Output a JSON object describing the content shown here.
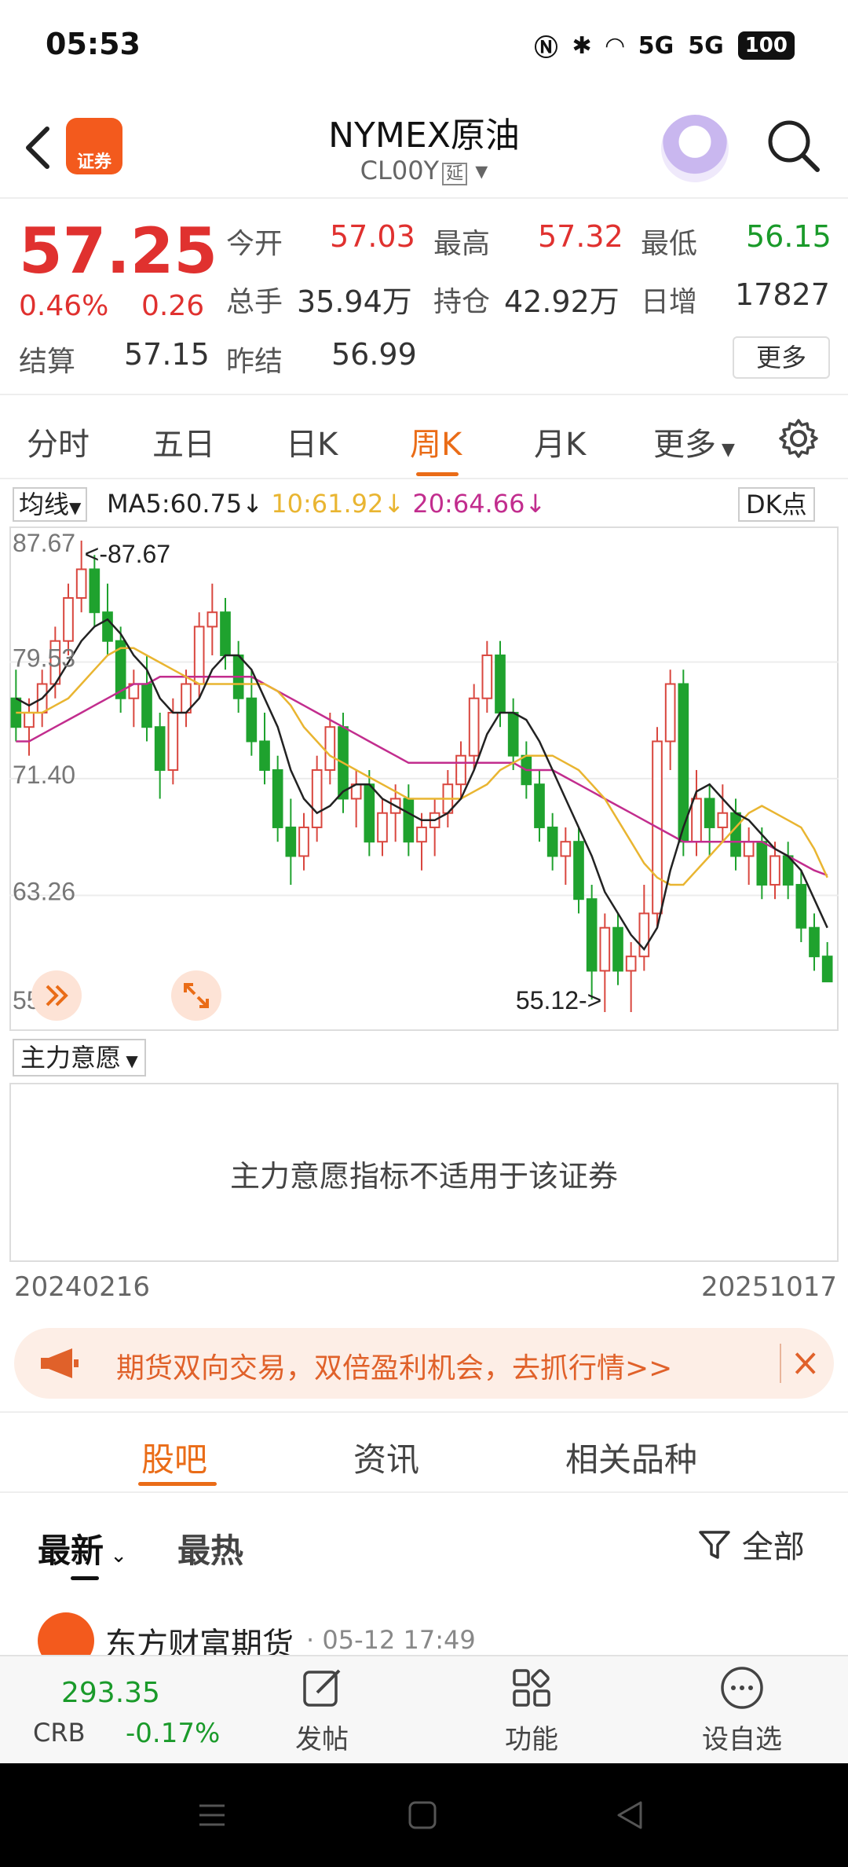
{
  "status": {
    "time": "05:53",
    "battery": "100",
    "net1": "5G",
    "net2": "5G"
  },
  "header": {
    "title": "NYMEX原油",
    "code": "CL00Y",
    "delay_tag": "延",
    "logo_text": "证券"
  },
  "quote": {
    "last": "57.25",
    "change_pct": "0.46%",
    "change": "0.26",
    "open_label": "今开",
    "open": "57.03",
    "high_label": "最高",
    "high": "57.32",
    "low_label": "最低",
    "low": "56.15",
    "volume_label": "总手",
    "volume": "35.94万",
    "oi_label": "持仓",
    "oi": "42.92万",
    "daily_inc_label": "日增",
    "daily_inc": "17827",
    "settle_label": "结算",
    "settle": "57.15",
    "prev_settle_label": "昨结",
    "prev_settle": "56.99",
    "more_label": "更多"
  },
  "period_tabs": [
    "分时",
    "五日",
    "日K",
    "周K",
    "月K",
    "更多"
  ],
  "active_period": "周K",
  "ma_legend": {
    "selector": "均线",
    "ma5": "MA5:60.75",
    "ma10": "10:61.92",
    "ma20": "20:64.66",
    "dk_label": "DK点",
    "colors": {
      "ma5": "#222222",
      "ma10": "#e9b531",
      "ma20": "#c22d8e"
    }
  },
  "chart_data": {
    "type": "candlestick",
    "y_ticks": [
      "87.67",
      "79.53",
      "71.40",
      "63.26",
      "55.12"
    ],
    "ylim": [
      55.12,
      87.67
    ],
    "max_marker": "<-87.67",
    "min_marker": "55.12->",
    "x_start": "20240216",
    "x_end": "20251017",
    "up_color": "#d9473f",
    "down_color": "#1fa22e",
    "ohlc": [
      [
        77,
        79,
        74,
        75
      ],
      [
        75,
        77,
        73,
        76
      ],
      [
        76,
        79,
        75,
        78
      ],
      [
        78,
        82,
        77,
        81
      ],
      [
        81,
        85,
        80,
        84
      ],
      [
        84,
        88,
        83,
        86
      ],
      [
        86,
        87,
        82,
        83
      ],
      [
        83,
        85,
        80,
        81
      ],
      [
        81,
        82,
        76,
        77
      ],
      [
        77,
        79,
        75,
        78
      ],
      [
        78,
        80,
        74,
        75
      ],
      [
        75,
        76,
        70,
        72
      ],
      [
        72,
        77,
        71,
        76
      ],
      [
        76,
        79,
        75,
        78
      ],
      [
        78,
        83,
        77,
        82
      ],
      [
        82,
        85,
        80,
        83
      ],
      [
        83,
        84,
        79,
        80
      ],
      [
        80,
        81,
        76,
        77
      ],
      [
        77,
        79,
        73,
        74
      ],
      [
        74,
        76,
        71,
        72
      ],
      [
        72,
        73,
        67,
        68
      ],
      [
        68,
        70,
        64,
        66
      ],
      [
        66,
        69,
        65,
        68
      ],
      [
        68,
        73,
        67,
        72
      ],
      [
        72,
        76,
        71,
        75
      ],
      [
        75,
        76,
        69,
        70
      ],
      [
        70,
        72,
        68,
        71
      ],
      [
        71,
        72,
        66,
        67
      ],
      [
        67,
        70,
        66,
        69
      ],
      [
        69,
        71,
        67,
        70
      ],
      [
        70,
        71,
        66,
        67
      ],
      [
        67,
        69,
        65,
        68
      ],
      [
        68,
        70,
        66,
        69
      ],
      [
        69,
        72,
        68,
        71
      ],
      [
        71,
        74,
        70,
        73
      ],
      [
        73,
        78,
        72,
        77
      ],
      [
        77,
        81,
        76,
        80
      ],
      [
        80,
        81,
        75,
        76
      ],
      [
        76,
        77,
        72,
        73
      ],
      [
        73,
        74,
        70,
        71
      ],
      [
        71,
        72,
        67,
        68
      ],
      [
        68,
        69,
        65,
        66
      ],
      [
        66,
        68,
        64,
        67
      ],
      [
        67,
        68,
        62,
        63
      ],
      [
        63,
        64,
        56,
        58
      ],
      [
        58,
        62,
        55.12,
        61
      ],
      [
        61,
        62,
        57,
        58
      ],
      [
        58,
        60,
        55.12,
        59
      ],
      [
        59,
        64,
        58,
        62
      ],
      [
        62,
        75,
        61,
        74
      ],
      [
        74,
        79,
        72,
        78
      ],
      [
        78,
        79,
        66,
        67
      ],
      [
        67,
        72,
        66,
        70
      ],
      [
        70,
        71,
        66,
        68
      ],
      [
        68,
        71,
        67,
        69
      ],
      [
        69,
        70,
        65,
        66
      ],
      [
        66,
        68,
        64,
        67
      ],
      [
        67,
        68,
        63,
        64
      ],
      [
        64,
        67,
        63,
        66
      ],
      [
        66,
        67,
        63,
        64
      ],
      [
        64,
        65,
        60,
        61
      ],
      [
        61,
        62,
        58,
        59
      ],
      [
        59,
        60,
        57.5,
        57.25
      ]
    ],
    "ma5": [
      77,
      76.5,
      77,
      78,
      79.5,
      81,
      82,
      82.5,
      81.5,
      80,
      79,
      77,
      76,
      76,
      77,
      79,
      80,
      80,
      79,
      77,
      75,
      72,
      70,
      69,
      69.5,
      70.5,
      71,
      71,
      70,
      69.5,
      69,
      68.5,
      68.5,
      69,
      70,
      72,
      74.5,
      76,
      76,
      75.5,
      74,
      72,
      70,
      68,
      66,
      63.5,
      62,
      60.5,
      59.5,
      61,
      65,
      68,
      70.5,
      71,
      70,
      69,
      68.5,
      67.5,
      66.5,
      66,
      65,
      63,
      61
    ],
    "ma10": [
      76,
      76,
      76,
      76.5,
      77,
      78,
      79,
      80,
      80.5,
      80.5,
      80,
      79.5,
      79,
      78.5,
      78,
      78,
      78,
      78,
      78,
      78,
      77.5,
      76.5,
      75,
      74,
      73,
      72.5,
      72,
      71.5,
      71,
      70.5,
      70,
      70,
      70,
      70,
      70,
      70.5,
      71,
      72,
      72.5,
      73,
      73,
      73,
      72.5,
      72,
      71,
      70,
      68.5,
      67,
      65.5,
      64.5,
      64,
      64,
      65,
      66,
      67,
      68,
      69,
      69.5,
      69,
      68.5,
      68,
      66.5,
      64.5
    ],
    "ma20": [
      74,
      74,
      74.5,
      75,
      75.5,
      76,
      76.5,
      77,
      77.5,
      78,
      78,
      78.5,
      78.5,
      78.5,
      78.5,
      78.5,
      78.5,
      78.5,
      78.5,
      78,
      77.5,
      77,
      76.5,
      76,
      75.5,
      75,
      74.5,
      74,
      73.5,
      73,
      72.5,
      72.5,
      72.5,
      72.5,
      72.5,
      72.5,
      72.5,
      72.5,
      72.5,
      72,
      72,
      72,
      71.5,
      71,
      70.5,
      70,
      69.5,
      69,
      68.5,
      68,
      67.5,
      67,
      67,
      67,
      67,
      67,
      67,
      67,
      66.5,
      66,
      65.5,
      65,
      64.66
    ]
  },
  "indicator": {
    "selector": "主力意愿",
    "message": "主力意愿指标不适用于该证券"
  },
  "promo": {
    "text": "期货双向交易，双倍盈利机会，去抓行情>>"
  },
  "content_tabs": [
    "股吧",
    "资讯",
    "相关品种"
  ],
  "sort": {
    "newest": "最新",
    "hot": "最热",
    "filter": "全部"
  },
  "post": {
    "author": "东方财富期货",
    "time": "· 05-12 17:49"
  },
  "bottom_bar": {
    "crb_price": "293.35",
    "crb_label": "CRB",
    "crb_change": "-0.17%",
    "post_label": "发帖",
    "func_label": "功能",
    "watch_label": "设自选"
  }
}
